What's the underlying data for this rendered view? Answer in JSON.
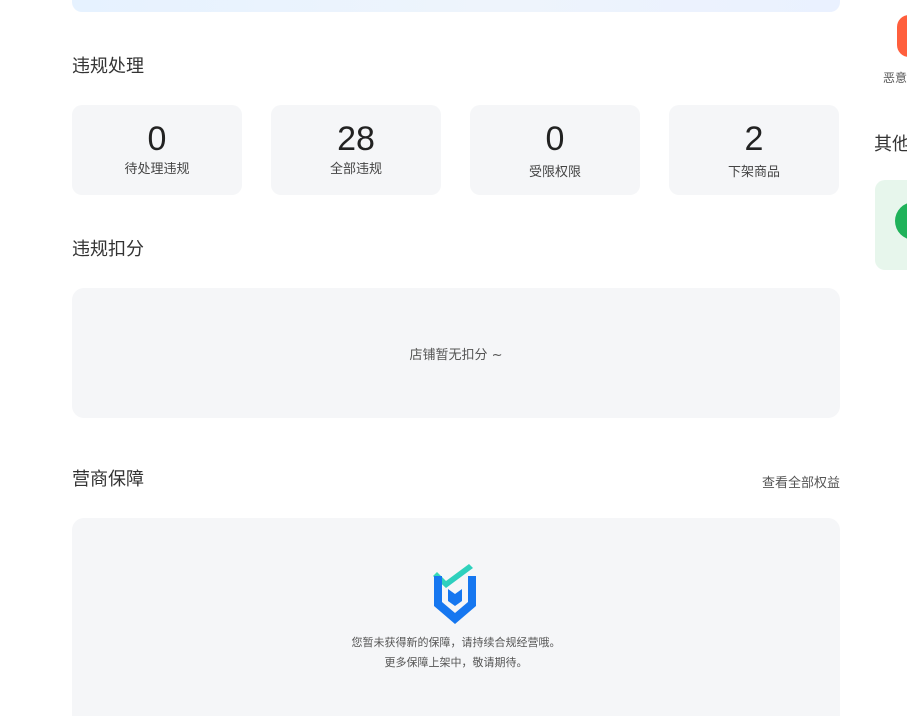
{
  "violation": {
    "title": "违规处理",
    "stats": [
      {
        "value": "0",
        "label": "待处理违规"
      },
      {
        "value": "28",
        "label": "全部违规"
      },
      {
        "value": "0",
        "label": "受限权限"
      },
      {
        "value": "2",
        "label": "下架商品"
      }
    ]
  },
  "deduction": {
    "title": "违规扣分",
    "empty_text": "店铺暂无扣分 ~"
  },
  "guarantee": {
    "title": "营商保障",
    "view_all": "查看全部权益",
    "line1": "您暂未获得新的保障，请持续合规经营哦。",
    "line2": "更多保障上架中，敬请期待。"
  },
  "right_column": {
    "malicious_label": "恶意",
    "other_title": "其他"
  },
  "colors": {
    "accent_orange": "#ff5f3d",
    "accent_green": "#1fb25a",
    "card_bg": "#f5f6f8"
  }
}
